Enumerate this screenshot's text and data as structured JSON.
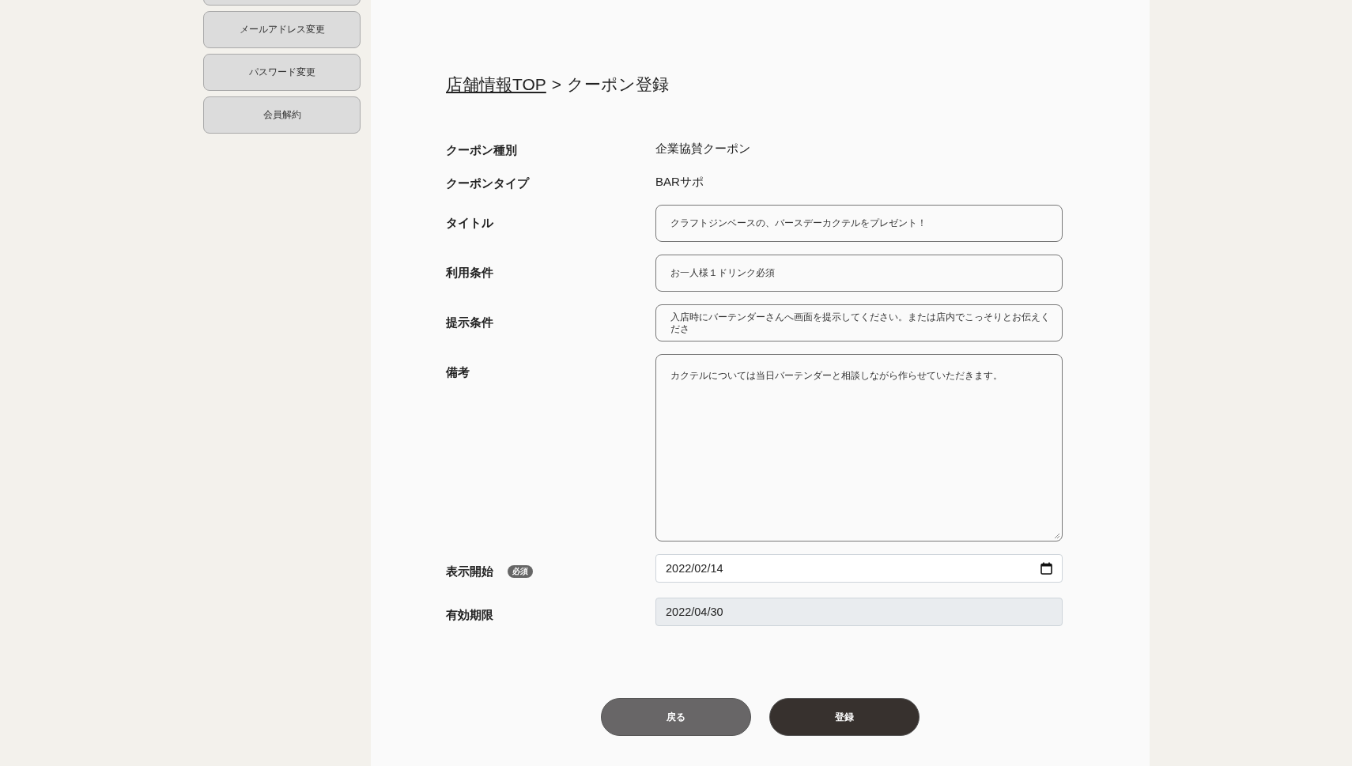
{
  "sidebar": {
    "items": [
      {
        "label": "メールアドレス変更"
      },
      {
        "label": "パスワード変更"
      },
      {
        "label": "会員解約"
      }
    ]
  },
  "breadcrumb": {
    "link": "店舗情報TOP",
    "separator": ">",
    "current": "クーポン登録"
  },
  "form": {
    "rows": [
      {
        "kind": "static",
        "label": "クーポン種別",
        "value": "企業協賛クーポン"
      },
      {
        "kind": "static",
        "label": "クーポンタイプ",
        "value": "BARサポ"
      },
      {
        "kind": "input",
        "label": "タイトル",
        "value": "クラフトジンベースの、バースデーカクテルをプレゼント！"
      },
      {
        "kind": "input",
        "label": "利用条件",
        "value": "お一人様１ドリンク必須"
      },
      {
        "kind": "input",
        "label": "提示条件",
        "value": "入店時にバーテンダーさんへ画面を提示してください。または店内でこっそりとお伝えくださ"
      },
      {
        "kind": "textarea",
        "label": "備考",
        "value": "カクテルについては当日バーテンダーと相談しながら作らせていただきます。"
      },
      {
        "kind": "date",
        "label": "表示開始",
        "badge": "必須",
        "value": "2022/02/14",
        "disabled": false
      },
      {
        "kind": "date",
        "label": "有効期限",
        "value": "2022/04/30",
        "disabled": true
      }
    ]
  },
  "buttons": [
    {
      "label": "戻る",
      "kind": "secondary"
    },
    {
      "label": "登録",
      "kind": "primary"
    }
  ]
}
